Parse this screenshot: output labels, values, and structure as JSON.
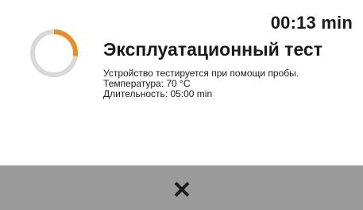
{
  "header": {
    "timer": "00:13 min",
    "title": "Эксплуатационный тест"
  },
  "details": {
    "line1": "Устройство тестируется при помощи пробы.",
    "line2": "Температура: 70 °C",
    "line3": "Длительность: 05:00 min"
  },
  "progress": {
    "fraction": 0.27,
    "track_color": "#d9d9d9",
    "arc_color": "#f08c1e"
  },
  "footer": {
    "icon": "close-icon",
    "background": "#9a9a9a"
  }
}
